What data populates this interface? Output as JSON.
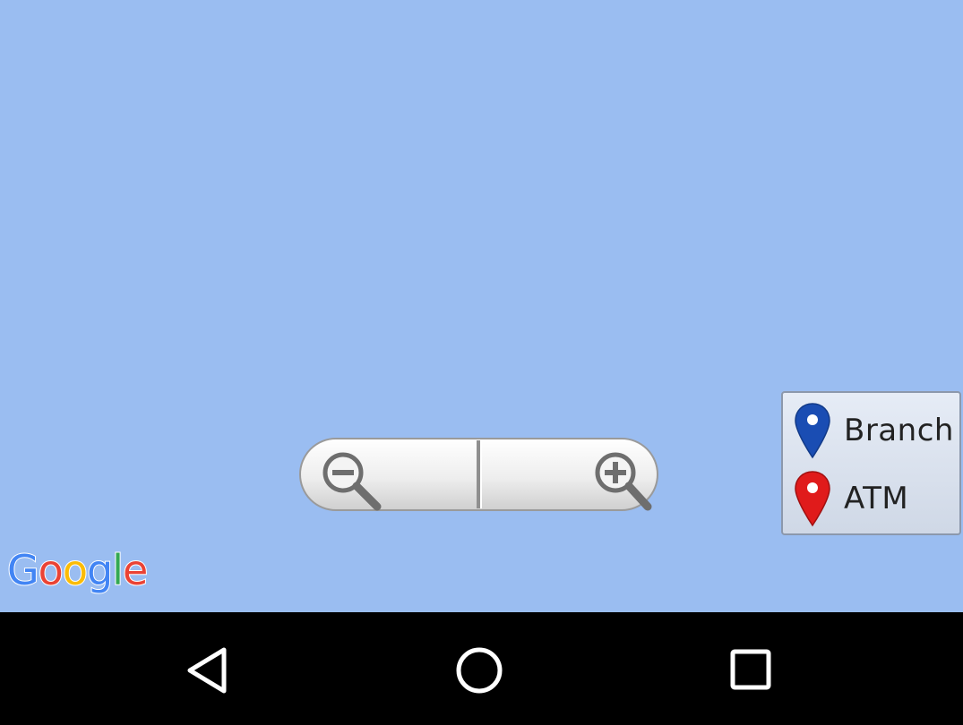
{
  "map": {
    "background_color": "#9abdf1",
    "attribution": {
      "letters": [
        "G",
        "o",
        "o",
        "g",
        "l",
        "e"
      ],
      "colors": [
        "#4285f4",
        "#ea4335",
        "#fbbc05",
        "#4285f4",
        "#34a853",
        "#ea4335"
      ]
    }
  },
  "zoom_controls": {
    "zoom_out_icon": "zoom-out-magnifier-icon",
    "zoom_in_icon": "zoom-in-magnifier-icon"
  },
  "legend": {
    "items": [
      {
        "label": "Branch",
        "icon": "blue-map-pin-icon",
        "color": "#1a4db3"
      },
      {
        "label": "ATM",
        "icon": "red-map-pin-icon",
        "color": "#e01b1b"
      }
    ]
  },
  "navigation_bar": {
    "back_icon": "back-triangle-icon",
    "home_icon": "home-circle-icon",
    "recents_icon": "recents-square-icon"
  }
}
